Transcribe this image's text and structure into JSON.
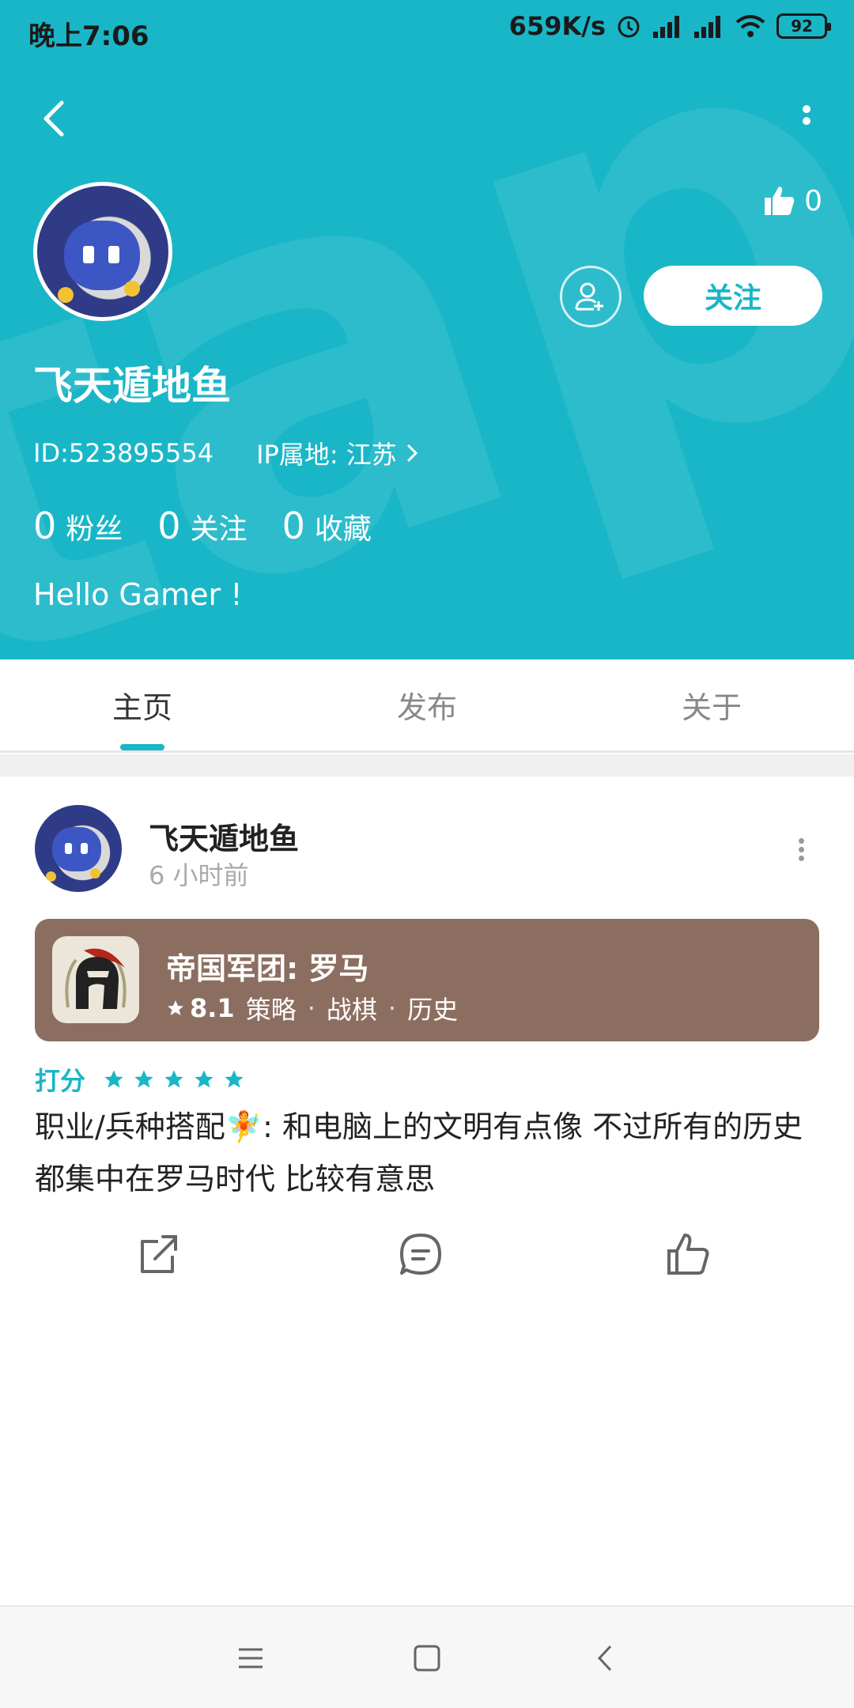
{
  "status_bar": {
    "time": "晚上7:06",
    "net_speed": "659K/s",
    "battery": "92"
  },
  "profile": {
    "name": "飞天遁地鱼",
    "id_text": "ID:523895554",
    "ip_text": "IP属地: 江苏",
    "likes": "0",
    "follow_label": "关注",
    "bio": "Hello Gamer !",
    "stats": [
      {
        "num": "0",
        "label": "粉丝"
      },
      {
        "num": "0",
        "label": "关注"
      },
      {
        "num": "0",
        "label": "收藏"
      }
    ]
  },
  "tabs": [
    {
      "label": "主页",
      "active": true
    },
    {
      "label": "发布",
      "active": false
    },
    {
      "label": "关于",
      "active": false
    }
  ],
  "post": {
    "author": "飞天遁地鱼",
    "time": "6 小时前",
    "game": {
      "title": "帝国军团: 罗马",
      "score": "8.1",
      "tags": [
        "策略",
        "战棋",
        "历史"
      ],
      "sep": "·"
    },
    "rating_label": "打分",
    "rating_stars": 5,
    "text": "职业/兵种搭配🧚: 和电脑上的文明有点像 不过所有的历史都集中在罗马时代 比较有意思"
  },
  "colors": {
    "accent": "#19b6c7",
    "card": "#8c6e61"
  },
  "icons": [
    "back-arrow-icon",
    "more-vertical-icon",
    "thumbs-up-icon",
    "add-user-icon",
    "chevron-right-icon",
    "star-icon",
    "share-icon",
    "comment-icon",
    "like-icon",
    "menu-icon",
    "home-square-icon",
    "nav-back-icon"
  ]
}
